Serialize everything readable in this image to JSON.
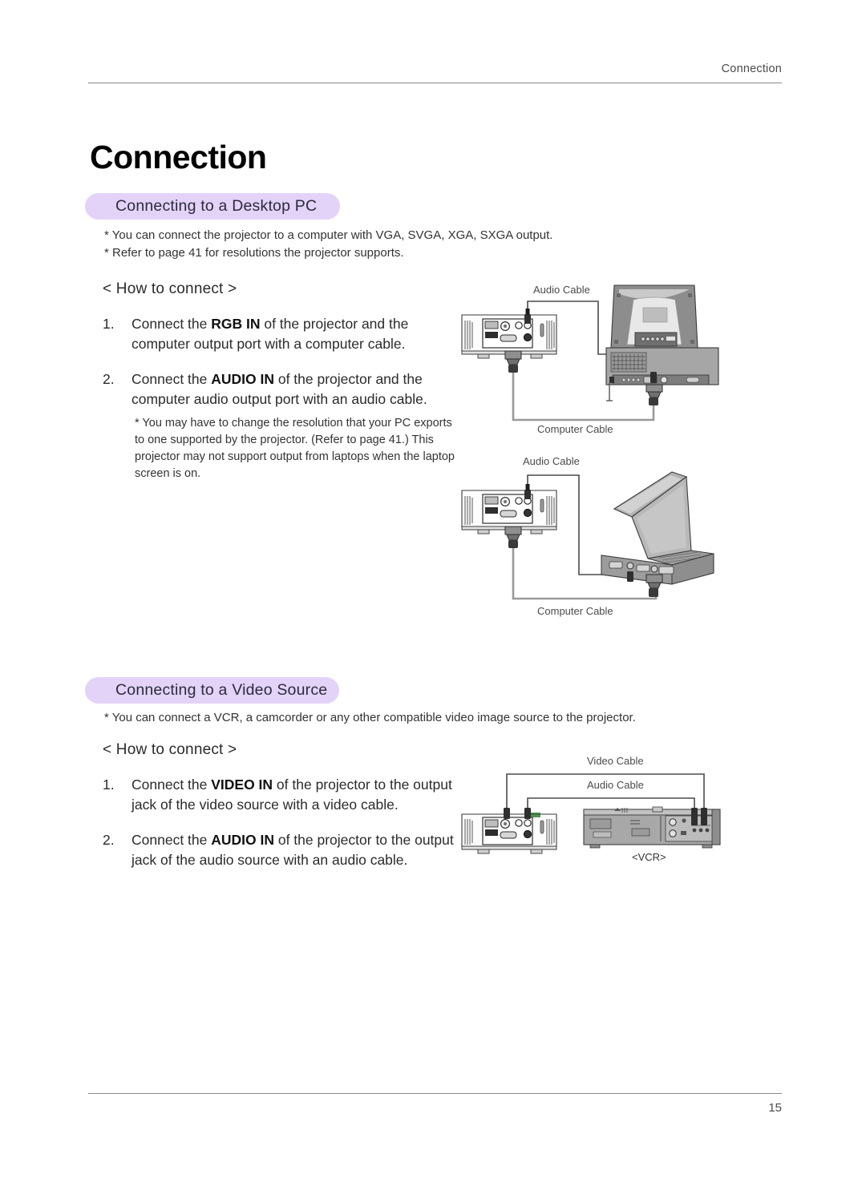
{
  "header": {
    "running_title": "Connection"
  },
  "footer": {
    "page_number": "15"
  },
  "chapter": {
    "title": "Connection"
  },
  "sections": {
    "desktop": {
      "pill_label": "Connecting to a Desktop PC",
      "bullets": [
        "* You can connect the projector to a computer with VGA, SVGA, XGA, SXGA output.",
        "* Refer to page 41 for resolutions the projector supports."
      ],
      "howto_label": "< How to connect >",
      "steps": [
        {
          "num": "1.",
          "pre": "Connect the ",
          "bold": "RGB IN",
          "post": " of the projector and the computer output port with a computer cable."
        },
        {
          "num": "2.",
          "pre": "Connect the ",
          "bold": "AUDIO IN",
          "post": " of the projector and the computer audio output port with an audio cable."
        }
      ],
      "note": "* You may have to change the resolution that your PC exports to one supported by the projector. (Refer to page 41.) This projector may not support output from laptops when the laptop screen is on."
    },
    "video": {
      "pill_label": "Connecting to a Video Source",
      "bullets": [
        "* You can connect a VCR, a camcorder or any other compatible video image source to the projector."
      ],
      "howto_label": "< How to connect >",
      "steps": [
        {
          "num": "1.",
          "pre": "Connect the ",
          "bold": "VIDEO IN",
          "post": " of the projector to the output jack of the video source with a video cable."
        },
        {
          "num": "2.",
          "pre": "Connect the ",
          "bold": "AUDIO IN",
          "post": " of the projector to the output jack of the audio source with an audio cable."
        }
      ]
    }
  },
  "figures": {
    "desktop_pc": {
      "audio_cable_label": "Audio Cable",
      "computer_cable_label": "Computer Cable"
    },
    "laptop": {
      "audio_cable_label": "Audio Cable",
      "computer_cable_label": "Computer Cable"
    },
    "vcr": {
      "video_cable_label": "Video Cable",
      "audio_cable_label": "Audio Cable",
      "device_caption": "<VCR>"
    }
  },
  "colors": {
    "pill_background": "#e4d3f8",
    "rule": "#8a8a8a",
    "device_gray": "#8c8c8c",
    "device_light": "#d9d9d9"
  }
}
